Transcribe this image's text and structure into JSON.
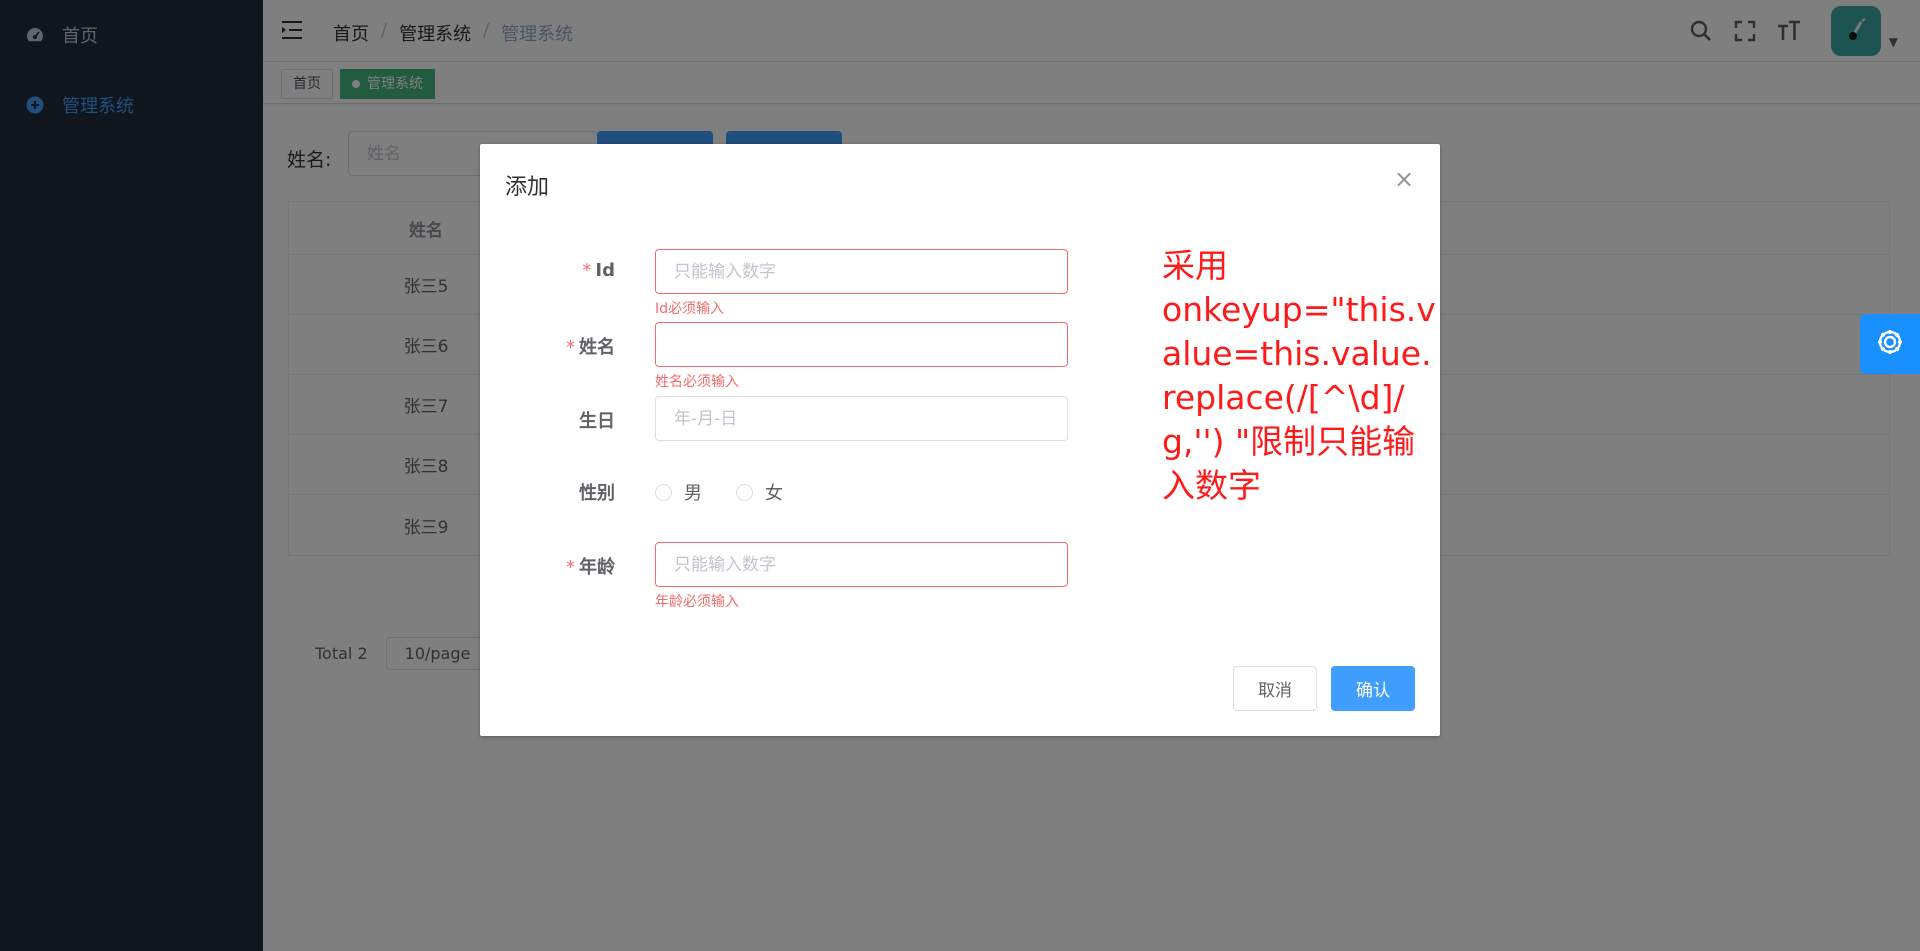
{
  "sidebar": {
    "items": [
      {
        "label": "首页",
        "icon": "dashboard-icon"
      },
      {
        "label": "管理系统",
        "icon": "plus-circle-icon"
      }
    ]
  },
  "navbar": {
    "breadcrumb": [
      "首页",
      "管理系统",
      "管理系统"
    ]
  },
  "tagsview": {
    "tags": [
      "首页",
      "管理系统"
    ]
  },
  "search": {
    "label": "姓名:",
    "placeholder": "姓名"
  },
  "table": {
    "header": "姓名",
    "rows": [
      "张三5",
      "张三6",
      "张三7",
      "张三8",
      "张三9"
    ]
  },
  "pagination": {
    "total": "Total 2",
    "page_size": "10/page"
  },
  "dialog": {
    "title": "添加",
    "fields": {
      "id": {
        "label": "Id",
        "placeholder": "只能输入数字",
        "error": "Id必须输入"
      },
      "name": {
        "label": "姓名",
        "placeholder": "",
        "error": "姓名必须输入"
      },
      "birthday": {
        "label": "生日",
        "placeholder": "年-月-日"
      },
      "gender": {
        "label": "性别",
        "options": [
          "男",
          "女"
        ]
      },
      "age": {
        "label": "年龄",
        "placeholder": "只能输入数字",
        "error": "年龄必须输入"
      }
    },
    "required_mark": "*",
    "cancel_label": "取消",
    "confirm_label": "确认",
    "annotation": {
      "line1": "采用",
      "line2": "onkeyup=\"this.value=this.value.replace(/[^\\d]/g,'') \"限制只能输入数字"
    }
  },
  "colors": {
    "sidebar_bg": "#1f2d3d",
    "primary": "#409eff",
    "error": "#f56c6c",
    "tag_active": "#42b983",
    "annotation": "#ff1a1a"
  }
}
